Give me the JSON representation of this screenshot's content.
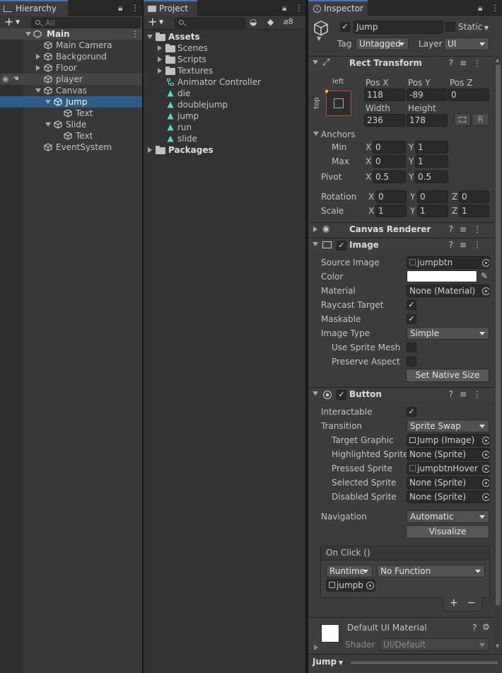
{
  "hierarchy": {
    "tab_label": "Hierarchy",
    "search_placeholder": "All",
    "items": [
      {
        "label": "Main"
      },
      {
        "label": "Main Camera"
      },
      {
        "label": "Backgorund"
      },
      {
        "label": "Floor"
      },
      {
        "label": "player"
      },
      {
        "label": "Canvas"
      },
      {
        "label": "Jump"
      },
      {
        "label": "Text"
      },
      {
        "label": "Slide"
      },
      {
        "label": "Text"
      },
      {
        "label": "EventSystem"
      }
    ]
  },
  "project": {
    "tab_label": "Project",
    "hidden_count": "8",
    "items": [
      {
        "label": "Assets"
      },
      {
        "label": "Scenes"
      },
      {
        "label": "Scripts"
      },
      {
        "label": "Textures"
      },
      {
        "label": "Animator Controller"
      },
      {
        "label": "die"
      },
      {
        "label": "doublejump"
      },
      {
        "label": "jump"
      },
      {
        "label": "run"
      },
      {
        "label": "slide"
      },
      {
        "label": "Packages"
      }
    ]
  },
  "inspector": {
    "tab_label": "Inspector",
    "object_name": "Jump",
    "static_label": "Static",
    "tag_label": "Tag",
    "tag_value": "Untagged",
    "layer_label": "Layer",
    "layer_value": "UI",
    "rect_transform": {
      "title": "Rect Transform",
      "anchor_preset_h": "left",
      "anchor_preset_v": "top",
      "posx_label": "Pos X",
      "posx": "118",
      "posy_label": "Pos Y",
      "posy": "-89",
      "posz_label": "Pos Z",
      "posz": "0",
      "width_label": "Width",
      "width": "236",
      "height_label": "Height",
      "height": "178",
      "r_label": "R",
      "anchors_label": "Anchors",
      "min_label": "Min",
      "min_x": "0",
      "min_y": "1",
      "max_label": "Max",
      "max_x": "0",
      "max_y": "1",
      "pivot_label": "Pivot",
      "pivot_x": "0.5",
      "pivot_y": "0.5",
      "rotation_label": "Rotation",
      "rot_x": "0",
      "rot_y": "0",
      "rot_z": "0",
      "scale_label": "Scale",
      "scale_x": "1",
      "scale_y": "1",
      "scale_z": "1",
      "x": "X",
      "y": "Y",
      "z": "Z"
    },
    "canvas_renderer": {
      "title": "Canvas Renderer"
    },
    "image": {
      "title": "Image",
      "source_image_label": "Source Image",
      "source_image": "jumpbtn",
      "color_label": "Color",
      "color_value": "#ffffff",
      "material_label": "Material",
      "material": "None (Material)",
      "raycast_label": "Raycast Target",
      "maskable_label": "Maskable",
      "image_type_label": "Image Type",
      "image_type": "Simple",
      "use_sprite_mesh_label": "Use Sprite Mesh",
      "preserve_aspect_label": "Preserve Aspect",
      "set_native_size": "Set Native Size"
    },
    "button": {
      "title": "Button",
      "interactable_label": "Interactable",
      "transition_label": "Transition",
      "transition": "Sprite Swap",
      "target_graphic_label": "Target Graphic",
      "target_graphic": "Jump (Image)",
      "highlighted_label": "Highlighted Sprite",
      "highlighted": "None (Sprite)",
      "pressed_label": "Pressed Sprite",
      "pressed": "jumpbtnHover",
      "selected_label": "Selected Sprite",
      "selected": "None (Sprite)",
      "disabled_label": "Disabled Sprite",
      "disabled": "None (Sprite)",
      "navigation_label": "Navigation",
      "navigation": "Automatic",
      "visualize": "Visualize",
      "onclick_label": "On Click ()",
      "runtime": "Runtime",
      "function": "No Function",
      "object": "jumpb",
      "plus": "+",
      "minus": "−"
    },
    "material": {
      "title": "Default UI Material",
      "shader_label": "Shader",
      "shader": "UI/Default"
    },
    "footer_label": "Jump"
  }
}
